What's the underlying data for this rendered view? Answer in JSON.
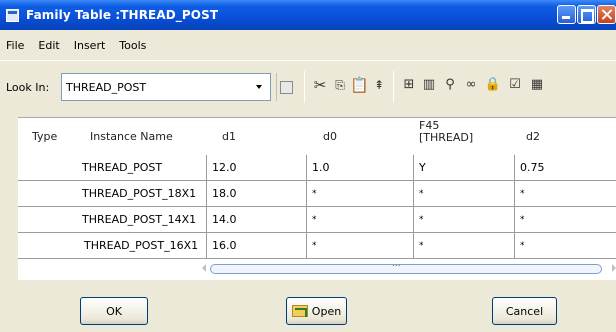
{
  "window": {
    "title": "Family Table :THREAD_POST"
  },
  "menu": [
    "File",
    "Edit",
    "Insert",
    "Tools"
  ],
  "toolbar": {
    "lookin_label": "Look In:",
    "lookin_value": "THREAD_POST",
    "icons": [
      "cut-icon",
      "copy-icon",
      "paste-icon",
      "insert-column-icon",
      "hierarchy-icon",
      "add-columns-icon",
      "find-icon",
      "glasses-icon",
      "lock-icon",
      "verify-icon",
      "table-icon"
    ]
  },
  "table": {
    "headers": {
      "type": "Type",
      "instance": "Instance Name",
      "d1": "d1",
      "d0": "d0",
      "f45_line1": "F45",
      "f45_line2": "[THREAD]",
      "d2": "d2"
    },
    "rows": [
      {
        "instance": "THREAD_POST",
        "d1": "12.0",
        "d0": "1.0",
        "f45": "Y",
        "d2": "0.75"
      },
      {
        "instance": "THREAD_POST_18X1",
        "d1": "18.0",
        "d0": "*",
        "f45": "*",
        "d2": "*"
      },
      {
        "instance": "THREAD_POST_14X1",
        "d1": "14.0",
        "d0": "*",
        "f45": "*",
        "d2": "*"
      },
      {
        "instance": "THREAD_POST_16X1",
        "d1": "16.0",
        "d0": "*",
        "f45": "*",
        "d2": "*"
      }
    ],
    "scroll_dots": "..."
  },
  "buttons": {
    "ok": "OK",
    "open": "Open",
    "cancel": "Cancel"
  }
}
